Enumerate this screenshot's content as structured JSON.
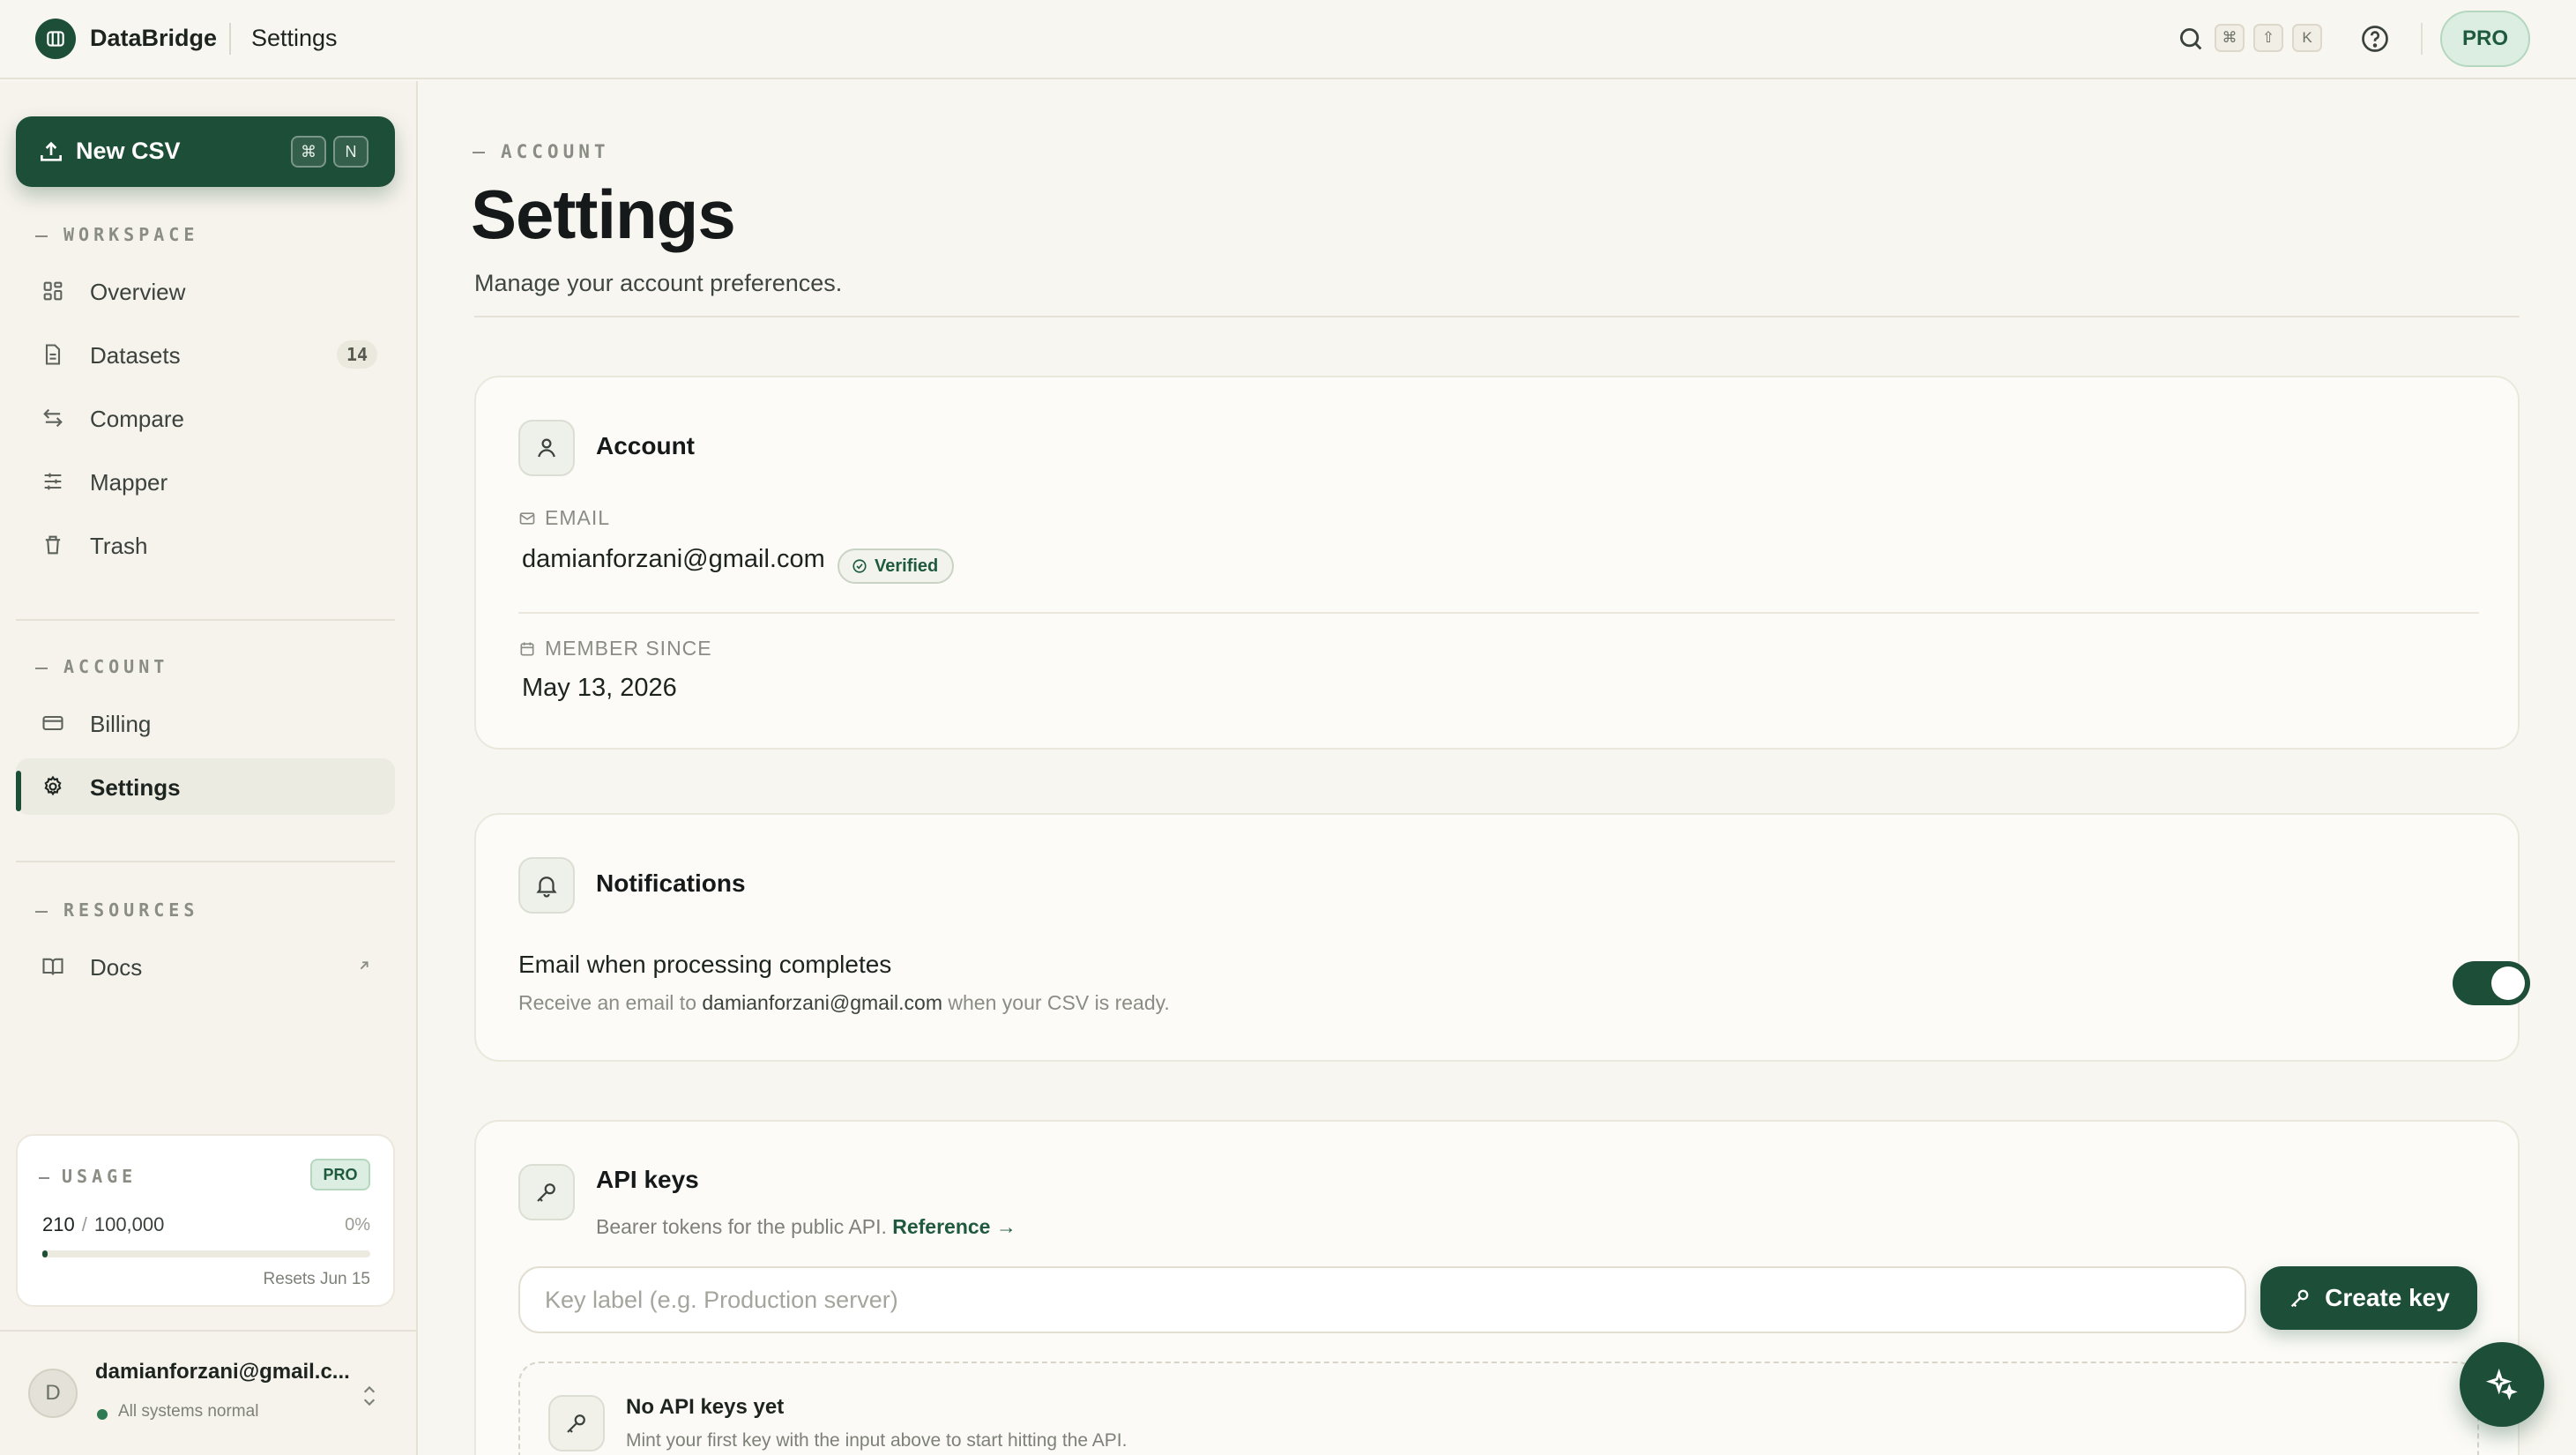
{
  "app": {
    "name": "DataBridge",
    "breadcrumb": "Settings"
  },
  "topbar": {
    "shortcut_keys": [
      "⌘",
      "⇧",
      "K"
    ],
    "plan_badge": "PRO"
  },
  "sidebar": {
    "new_button": {
      "label": "New CSV",
      "shortcut": [
        "⌘",
        "N"
      ]
    },
    "sections": {
      "workspace": "WORKSPACE",
      "account": "ACCOUNT",
      "resources": "RESOURCES"
    },
    "workspace_items": [
      {
        "label": "Overview",
        "icon": "grid-icon"
      },
      {
        "label": "Datasets",
        "icon": "file-icon",
        "count": "14"
      },
      {
        "label": "Compare",
        "icon": "arrows-swap-icon"
      },
      {
        "label": "Mapper",
        "icon": "sliders-icon"
      },
      {
        "label": "Trash",
        "icon": "trash-icon"
      }
    ],
    "account_items": [
      {
        "label": "Billing",
        "icon": "credit-card-icon"
      },
      {
        "label": "Settings",
        "icon": "gear-icon",
        "active": true
      }
    ],
    "resource_items": [
      {
        "label": "Docs",
        "icon": "book-icon",
        "external": true
      }
    ],
    "usage": {
      "label": "USAGE",
      "plan": "PRO",
      "used": "210",
      "limit": "100,000",
      "percent_text": "0%",
      "fraction": 0.0021,
      "resets": "Resets Jun 15"
    },
    "user": {
      "initial": "D",
      "email": "damianforzani@gmail.c...",
      "status": "All systems normal"
    }
  },
  "main": {
    "eyebrow": "ACCOUNT",
    "title": "Settings",
    "subtitle": "Manage your account preferences.",
    "account_card": {
      "title": "Account",
      "email_label": "EMAIL",
      "email_value": "damianforzani@gmail.com",
      "verified": "Verified",
      "member_label": "MEMBER SINCE",
      "member_value": "May 13, 2026"
    },
    "notifications_card": {
      "title": "Notifications",
      "setting_title": "Email when processing completes",
      "desc_prefix": "Receive an email to",
      "desc_email": "damianforzani@gmail.com",
      "desc_suffix": "when your CSV is ready.",
      "enabled": true
    },
    "api_card": {
      "title": "API keys",
      "subtitle": "Bearer tokens for the public API.",
      "reference_link": "Reference →",
      "input_placeholder": "Key label (e.g. Production server)",
      "create_button": "Create key",
      "empty_title": "No API keys yet",
      "empty_desc": "Mint your first key with the input above to start hitting the API."
    }
  },
  "colors": {
    "accent": "#1d4e37",
    "background": "#f8f6f0",
    "pro_badge_bg": "#dbeee1"
  }
}
